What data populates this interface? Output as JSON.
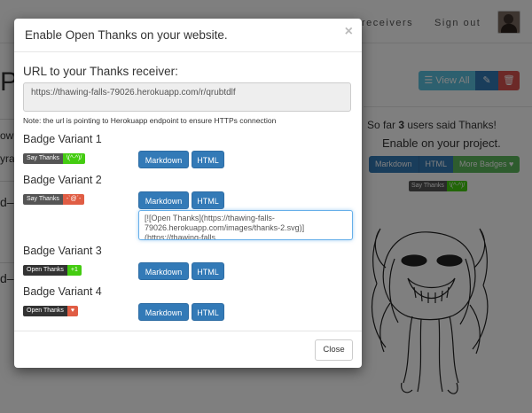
{
  "nav": {
    "receivers": "receivers",
    "signout": "Sign out"
  },
  "background": {
    "title_fragment": "P",
    "view_all": "View All",
    "so_far_prefix": "So far ",
    "so_far_count": "3",
    "so_far_suffix": " users said Thanks!",
    "enable_project": "Enable on your project.",
    "group_markdown": "Markdown",
    "group_html": "HTML",
    "group_more": "More Badges",
    "side_badge_left": "Say Thanks",
    "side_badge_right": "\\(^-^)/",
    "frag_1": "ow",
    "frag_2": "yra",
    "frag_3": "d–",
    "frag_4": "d–"
  },
  "modal": {
    "title": "Enable Open Thanks on your website.",
    "close_x": "×",
    "url_label": "URL to your Thanks receiver:",
    "url_value": "https://thawing-falls-79026.herokuapp.com/r/qrubtdlf",
    "note": "Note: the url is pointing to Herokuapp endpoint to ensure HTTPs connection",
    "variants": [
      {
        "label": "Badge Variant 1",
        "badge_left": "Say Thanks",
        "badge_right": "\\(^-^)/"
      },
      {
        "label": "Badge Variant 2",
        "badge_left": "Say Thanks",
        "badge_right": "-`@´-"
      },
      {
        "label": "Badge Variant 3",
        "badge_left": "Open Thanks",
        "badge_right": "+1"
      },
      {
        "label": "Badge Variant 4",
        "badge_left": "Open Thanks",
        "badge_right": "♥"
      }
    ],
    "markdown_label": "Markdown",
    "html_label": "HTML",
    "snippet": "[![Open Thanks](https://thawing-falls-79026.herokuapp.com/images/thanks-2.svg)](https://thawing-falls",
    "close_button": "Close"
  },
  "colors": {
    "primary": "#337ab7",
    "info": "#5bc0de",
    "danger": "#d9534f",
    "success": "#5cb85c",
    "badge_green": "#44cc11",
    "badge_red": "#e05d44"
  }
}
